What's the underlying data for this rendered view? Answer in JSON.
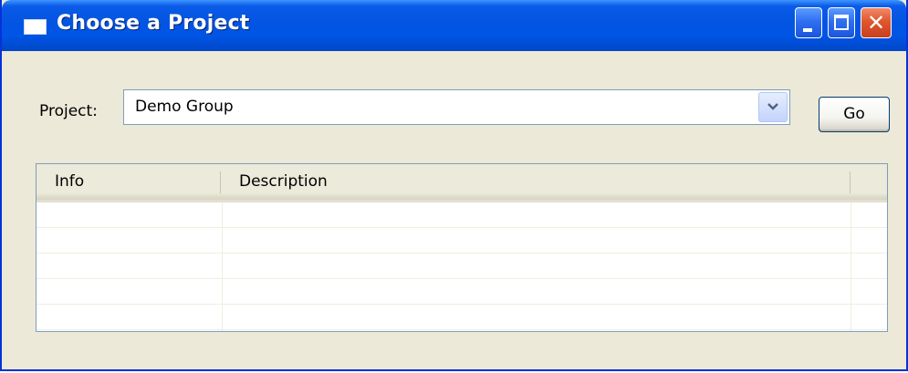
{
  "window": {
    "title": "Choose a Project",
    "icons": {
      "app": "window-icon",
      "minimize": "minimize-icon",
      "maximize": "maximize-icon",
      "close": "close-icon"
    },
    "colors": {
      "titlebar": "#0055e5",
      "background": "#ece9d8",
      "close_button": "#e0562e"
    }
  },
  "form": {
    "project_label": "Project:",
    "project_value": "Demo Group",
    "go_label": "Go"
  },
  "table": {
    "columns": [
      "Info",
      "Description"
    ],
    "rows": [
      [
        "",
        ""
      ],
      [
        "",
        ""
      ],
      [
        "",
        ""
      ],
      [
        "",
        ""
      ],
      [
        "",
        ""
      ]
    ]
  }
}
